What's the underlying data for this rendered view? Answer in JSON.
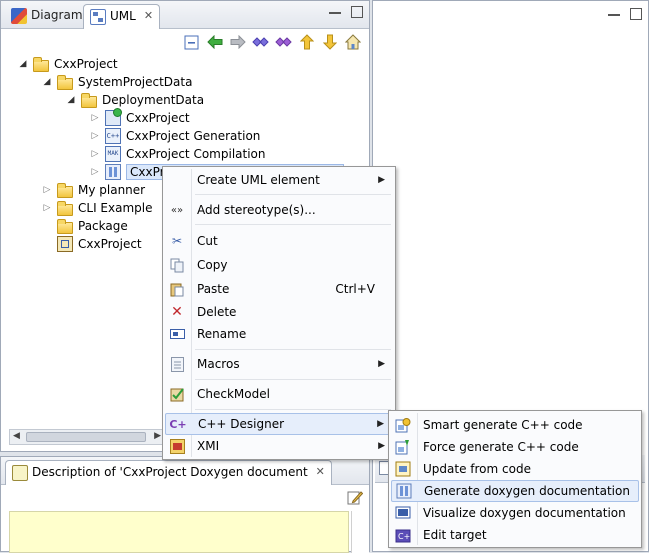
{
  "tabs": [
    {
      "label": "Diagrams",
      "icon": "diagrams-icon"
    },
    {
      "label": "UML",
      "icon": "uml-icon",
      "close": "✕"
    }
  ],
  "tree": [
    {
      "label": "CxxProject",
      "icon": "folder-icon",
      "twisty": "open"
    },
    {
      "label": "SystemProjectData",
      "icon": "folder-icon",
      "twisty": "open"
    },
    {
      "label": "DeploymentData",
      "icon": "folder-icon",
      "twisty": "open"
    },
    {
      "label": "CxxProject",
      "icon": "project-config-icon",
      "twisty": "closed"
    },
    {
      "label": "CxxProject Generation",
      "icon": "cxx-generation-icon",
      "twisty": "closed"
    },
    {
      "label": "CxxProject Compilation",
      "icon": "makefile-icon",
      "twisty": "closed"
    },
    {
      "label": "CxxPr",
      "icon": "doxygen-doc-icon",
      "twisty": "closed"
    },
    {
      "label": "My planner",
      "icon": "folder-icon",
      "twisty": "closed"
    },
    {
      "label": "CLI Example",
      "icon": "folder-icon",
      "twisty": "closed"
    },
    {
      "label": "Package",
      "icon": "package-icon",
      "twisty": "none"
    },
    {
      "label": "CxxProject",
      "icon": "model-icon",
      "twisty": "none"
    }
  ],
  "description_view": {
    "title": "Description of 'CxxProject Doxygen document",
    "close": "✕"
  },
  "context_menu": [
    {
      "label": "Create UML element",
      "submenu": true
    },
    {
      "label": "Add stereotype(s)...",
      "icon": "stereotype-icon"
    },
    {
      "label": "Cut",
      "icon": "scissors-icon"
    },
    {
      "label": "Copy",
      "icon": "copy-icon"
    },
    {
      "label": "Paste",
      "icon": "paste-icon",
      "shortcut": "Ctrl+V"
    },
    {
      "label": "Delete",
      "icon": "delete-icon"
    },
    {
      "label": "Rename",
      "icon": "rename-icon"
    },
    {
      "label": "Macros",
      "icon": "macros-icon",
      "submenu": true
    },
    {
      "label": "CheckModel",
      "icon": "checkmodel-icon"
    },
    {
      "label": "C++ Designer",
      "icon": "cpp-designer-icon",
      "submenu": true
    },
    {
      "label": "XMI",
      "icon": "xmi-icon",
      "submenu": true
    }
  ],
  "submenu": [
    {
      "label": "Smart generate C++ code",
      "icon": "smart-generate-icon"
    },
    {
      "label": "Force generate C++ code",
      "icon": "force-generate-icon"
    },
    {
      "label": "Update from code",
      "icon": "update-from-code-icon"
    },
    {
      "label": "Generate doxygen documentation",
      "icon": "generate-doxygen-icon"
    },
    {
      "label": "Visualize doxygen documentation",
      "icon": "visualize-doxygen-icon"
    },
    {
      "label": "Edit target",
      "icon": "edit-target-icon"
    }
  ],
  "colors": {
    "selection": "#dbe8fb",
    "menu_highlight": "#e6eefb",
    "description_bg": "#ffffcc",
    "folder": "#f2c53d"
  }
}
